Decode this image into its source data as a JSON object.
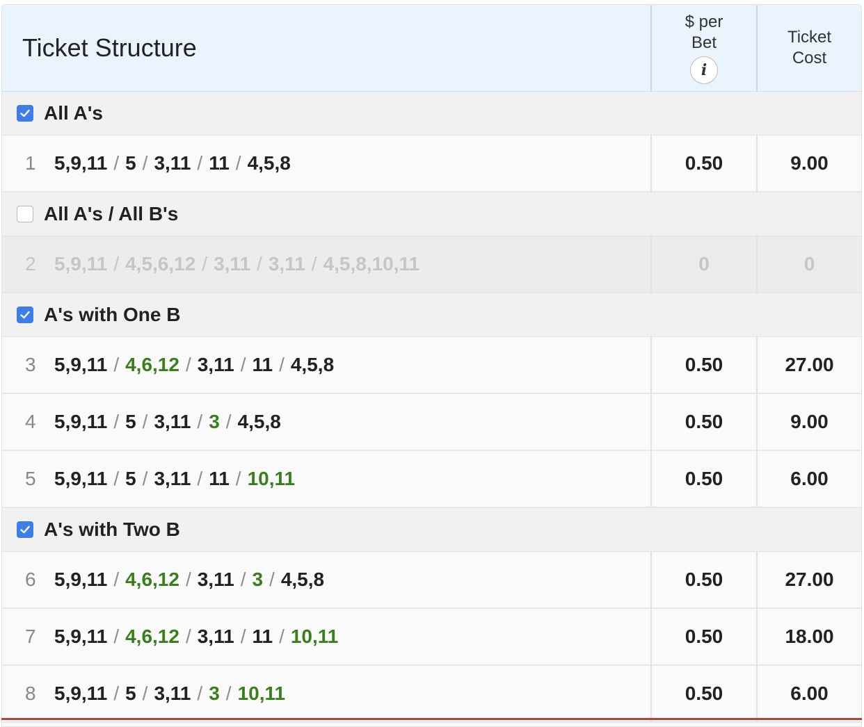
{
  "header": {
    "title": "Ticket Structure",
    "per_bet_label_1": "$ per",
    "per_bet_label_2": "Bet",
    "info_glyph": "i",
    "cost_label_1": "Ticket",
    "cost_label_2": "Cost"
  },
  "colors": {
    "checkbox_on": "#3f7ee8",
    "b_leg": "#3a7f1e",
    "header_bg": "#eaf4fe"
  },
  "groups": [
    {
      "label": "All A's",
      "checked": true,
      "rows": [
        {
          "num": "1",
          "legs": [
            [
              "5,9,11",
              "a"
            ],
            [
              "5",
              "a"
            ],
            [
              "3,11",
              "a"
            ],
            [
              "11",
              "a"
            ],
            [
              "4,5,8",
              "a"
            ]
          ],
          "per_bet": "0.50",
          "cost": "9.00",
          "disabled": false
        }
      ]
    },
    {
      "label": "All A's / All B's",
      "checked": false,
      "rows": [
        {
          "num": "2",
          "legs": [
            [
              "5,9,11",
              "a"
            ],
            [
              "4,5,6,12",
              "a"
            ],
            [
              "3,11",
              "a"
            ],
            [
              "3,11",
              "a"
            ],
            [
              "4,5,8,10,11",
              "a"
            ]
          ],
          "per_bet": "0",
          "cost": "0",
          "disabled": true
        }
      ]
    },
    {
      "label": "A's with One B",
      "checked": true,
      "rows": [
        {
          "num": "3",
          "legs": [
            [
              "5,9,11",
              "a"
            ],
            [
              "4,6,12",
              "b"
            ],
            [
              "3,11",
              "a"
            ],
            [
              "11",
              "a"
            ],
            [
              "4,5,8",
              "a"
            ]
          ],
          "per_bet": "0.50",
          "cost": "27.00",
          "disabled": false
        },
        {
          "num": "4",
          "legs": [
            [
              "5,9,11",
              "a"
            ],
            [
              "5",
              "a"
            ],
            [
              "3,11",
              "a"
            ],
            [
              "3",
              "b"
            ],
            [
              "4,5,8",
              "a"
            ]
          ],
          "per_bet": "0.50",
          "cost": "9.00",
          "disabled": false
        },
        {
          "num": "5",
          "legs": [
            [
              "5,9,11",
              "a"
            ],
            [
              "5",
              "a"
            ],
            [
              "3,11",
              "a"
            ],
            [
              "11",
              "a"
            ],
            [
              "10,11",
              "b"
            ]
          ],
          "per_bet": "0.50",
          "cost": "6.00",
          "disabled": false
        }
      ]
    },
    {
      "label": "A's with Two B",
      "checked": true,
      "rows": [
        {
          "num": "6",
          "legs": [
            [
              "5,9,11",
              "a"
            ],
            [
              "4,6,12",
              "b"
            ],
            [
              "3,11",
              "a"
            ],
            [
              "3",
              "b"
            ],
            [
              "4,5,8",
              "a"
            ]
          ],
          "per_bet": "0.50",
          "cost": "27.00",
          "disabled": false
        },
        {
          "num": "7",
          "legs": [
            [
              "5,9,11",
              "a"
            ],
            [
              "4,6,12",
              "b"
            ],
            [
              "3,11",
              "a"
            ],
            [
              "11",
              "a"
            ],
            [
              "10,11",
              "b"
            ]
          ],
          "per_bet": "0.50",
          "cost": "18.00",
          "disabled": false
        },
        {
          "num": "8",
          "legs": [
            [
              "5,9,11",
              "a"
            ],
            [
              "5",
              "a"
            ],
            [
              "3,11",
              "a"
            ],
            [
              "3",
              "b"
            ],
            [
              "10,11",
              "b"
            ]
          ],
          "per_bet": "0.50",
          "cost": "6.00",
          "disabled": false
        }
      ]
    }
  ],
  "separator": "/"
}
